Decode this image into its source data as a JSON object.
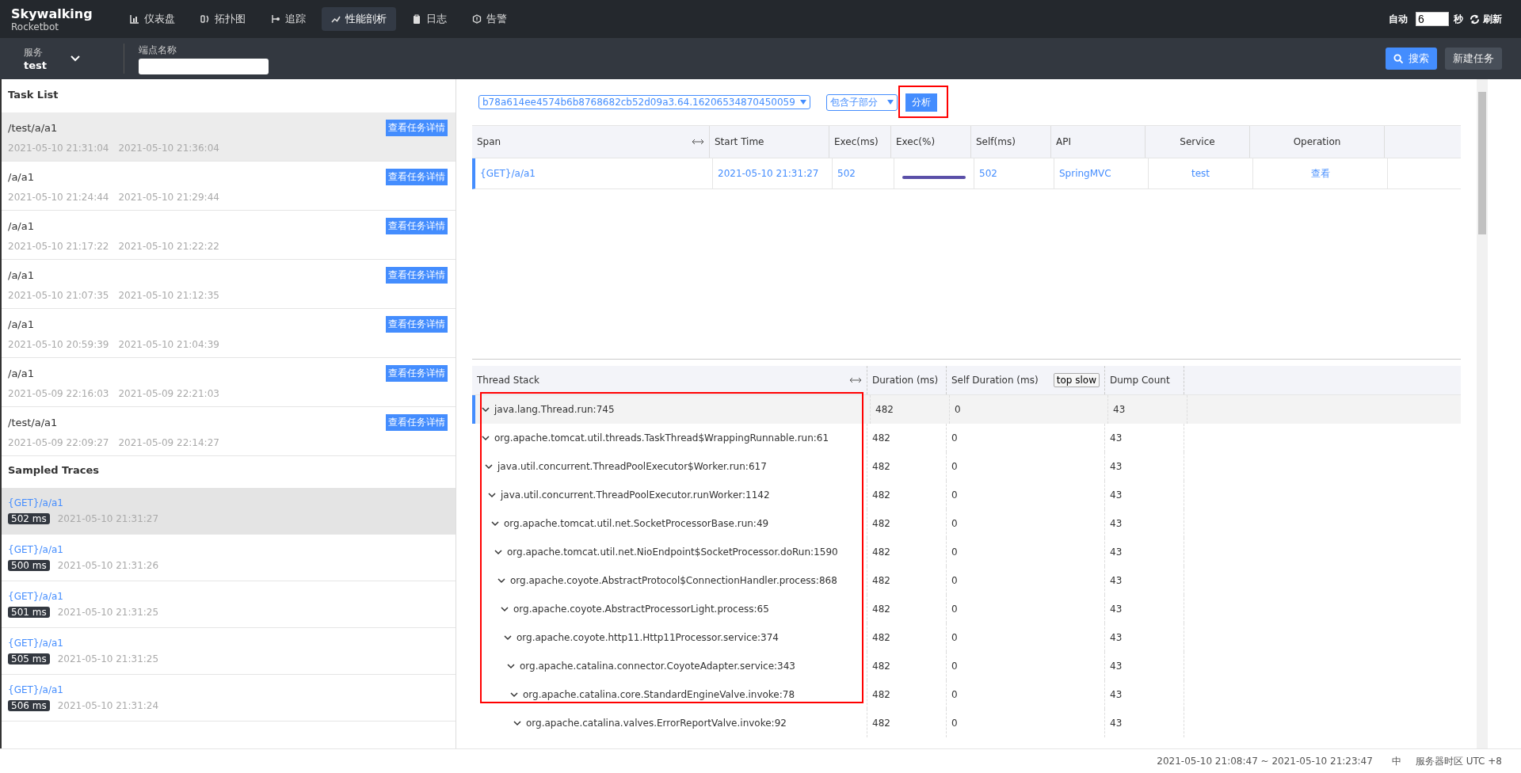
{
  "header": {
    "logo_title": "Skywalking",
    "logo_subtitle": "Rocketbot",
    "nav": [
      {
        "label": "仪表盘",
        "selected": false
      },
      {
        "label": "拓扑图",
        "selected": false
      },
      {
        "label": "追踪",
        "selected": false
      },
      {
        "label": "性能剖析",
        "selected": true
      },
      {
        "label": "日志",
        "selected": false
      },
      {
        "label": "告警",
        "selected": false
      }
    ],
    "auto_label": "自动",
    "interval": "6",
    "seconds_label": "秒",
    "refresh": "刷新"
  },
  "toolbar": {
    "service_label": "服务",
    "service_value": "test",
    "endpoint_label": "端点名称",
    "search": "搜索",
    "new_task": "新建任务"
  },
  "task_list": {
    "title": "Task List",
    "items": [
      {
        "endpoint": "/test/a/a1",
        "start": "2021-05-10 21:31:04",
        "end": "2021-05-10 21:36:04",
        "button": "查看任务详情",
        "selected": true
      },
      {
        "endpoint": "/a/a1",
        "start": "2021-05-10 21:24:44",
        "end": "2021-05-10 21:29:44",
        "button": "查看任务详情",
        "selected": false
      },
      {
        "endpoint": "/a/a1",
        "start": "2021-05-10 21:17:22",
        "end": "2021-05-10 21:22:22",
        "button": "查看任务详情",
        "selected": false
      },
      {
        "endpoint": "/a/a1",
        "start": "2021-05-10 21:07:35",
        "end": "2021-05-10 21:12:35",
        "button": "查看任务详情",
        "selected": false
      },
      {
        "endpoint": "/a/a1",
        "start": "2021-05-10 20:59:39",
        "end": "2021-05-10 21:04:39",
        "button": "查看任务详情",
        "selected": false
      },
      {
        "endpoint": "/a/a1",
        "start": "2021-05-09 22:16:03",
        "end": "2021-05-09 22:21:03",
        "button": "查看任务详情",
        "selected": false
      },
      {
        "endpoint": "/test/a/a1",
        "start": "2021-05-09 22:09:27",
        "end": "2021-05-09 22:14:27",
        "button": "查看任务详情",
        "selected": false
      }
    ]
  },
  "sampled_traces": {
    "title": "Sampled Traces",
    "items": [
      {
        "endpoint": "{GET}/a/a1",
        "duration": "502 ms",
        "time": "2021-05-10 21:31:27",
        "selected": true
      },
      {
        "endpoint": "{GET}/a/a1",
        "duration": "500 ms",
        "time": "2021-05-10 21:31:26",
        "selected": false
      },
      {
        "endpoint": "{GET}/a/a1",
        "duration": "501 ms",
        "time": "2021-05-10 21:31:25",
        "selected": false
      },
      {
        "endpoint": "{GET}/a/a1",
        "duration": "505 ms",
        "time": "2021-05-10 21:31:25",
        "selected": false
      },
      {
        "endpoint": "{GET}/a/a1",
        "duration": "506 ms",
        "time": "2021-05-10 21:31:24",
        "selected": false
      }
    ]
  },
  "analysis": {
    "segment": "b78a614ee4574b6b8768682cb52d09a3.64.16206534870450059",
    "mode": "包含子部分",
    "analyze": "分析",
    "span_table": {
      "columns": [
        "Span",
        "Start Time",
        "Exec(ms)",
        "Exec(%)",
        "Self(ms)",
        "API",
        "Service",
        "Operation"
      ],
      "rows": [
        {
          "span": "{GET}/a/a1",
          "start_time": "2021-05-10 21:31:27",
          "exec_ms": "502",
          "level": 1.0,
          "self_ms": "502",
          "api": "SpringMVC",
          "service": "test",
          "operation": "查看",
          "selected": true
        }
      ]
    },
    "thread_stack": {
      "columns": [
        "Thread Stack",
        "Duration (ms)",
        "Self Duration (ms)",
        "Dump Count"
      ],
      "top_slow": "top slow",
      "rows": [
        {
          "code": "java.lang.Thread.run:745",
          "duration": "482",
          "self_duration": "0",
          "dump_count": "43",
          "expanded": true,
          "selected": true,
          "children": [
            {
              "code": "org.apache.tomcat.util.threads.TaskThread$WrappingRunnable.run:61",
              "duration": "482",
              "self_duration": "0",
              "dump_count": "43",
              "expanded": true,
              "selected": false,
              "children": [
                {
                  "code": "java.util.concurrent.ThreadPoolExecutor$Worker.run:617",
                  "duration": "482",
                  "self_duration": "0",
                  "dump_count": "43",
                  "expanded": true,
                  "selected": false,
                  "children": [
                    {
                      "code": "java.util.concurrent.ThreadPoolExecutor.runWorker:1142",
                      "duration": "482",
                      "self_duration": "0",
                      "dump_count": "43",
                      "expanded": true,
                      "selected": false,
                      "children": [
                        {
                          "code": "org.apache.tomcat.util.net.SocketProcessorBase.run:49",
                          "duration": "482",
                          "self_duration": "0",
                          "dump_count": "43",
                          "expanded": true,
                          "selected": false,
                          "children": [
                            {
                              "code": "org.apache.tomcat.util.net.NioEndpoint$SocketProcessor.doRun:1590",
                              "duration": "482",
                              "self_duration": "0",
                              "dump_count": "43",
                              "expanded": true,
                              "selected": false,
                              "children": [
                                {
                                  "code": "org.apache.coyote.AbstractProtocol$ConnectionHandler.process:868",
                                  "duration": "482",
                                  "self_duration": "0",
                                  "dump_count": "43",
                                  "expanded": true,
                                  "selected": false,
                                  "children": [
                                    {
                                      "code": "org.apache.coyote.AbstractProcessorLight.process:65",
                                      "duration": "482",
                                      "self_duration": "0",
                                      "dump_count": "43",
                                      "expanded": true,
                                      "selected": false,
                                      "children": [
                                        {
                                          "code": "org.apache.coyote.http11.Http11Processor.service:374",
                                          "duration": "482",
                                          "self_duration": "0",
                                          "dump_count": "43",
                                          "expanded": true,
                                          "selected": false,
                                          "children": [
                                            {
                                              "code": "org.apache.catalina.connector.CoyoteAdapter.service:343",
                                              "duration": "482",
                                              "self_duration": "0",
                                              "dump_count": "43",
                                              "expanded": true,
                                              "selected": false,
                                              "children": [
                                                {
                                                  "code": "org.apache.catalina.core.StandardEngineValve.invoke:78",
                                                  "duration": "482",
                                                  "self_duration": "0",
                                                  "dump_count": "43",
                                                  "expanded": true,
                                                  "selected": false,
                                                  "children": [
                                                    {
                                                      "code": "org.apache.catalina.valves.ErrorReportValve.invoke:92",
                                                      "duration": "482",
                                                      "self_duration": "0",
                                                      "dump_count": "43",
                                                      "expanded": true,
                                                      "selected": false
                                                    }
                                                  ]
                                                }
                                              ]
                                            }
                                          ]
                                        }
                                      ]
                                    }
                                  ]
                                }
                              ]
                            }
                          ]
                        }
                      ]
                    }
                  ]
                }
              ]
            }
          ]
        }
      ]
    }
  },
  "footer": {
    "range": "2021-05-10 21:08:47 ~ 2021-05-10 21:23:47",
    "language": "中",
    "timezone": "服务器时区 UTC +8"
  }
}
